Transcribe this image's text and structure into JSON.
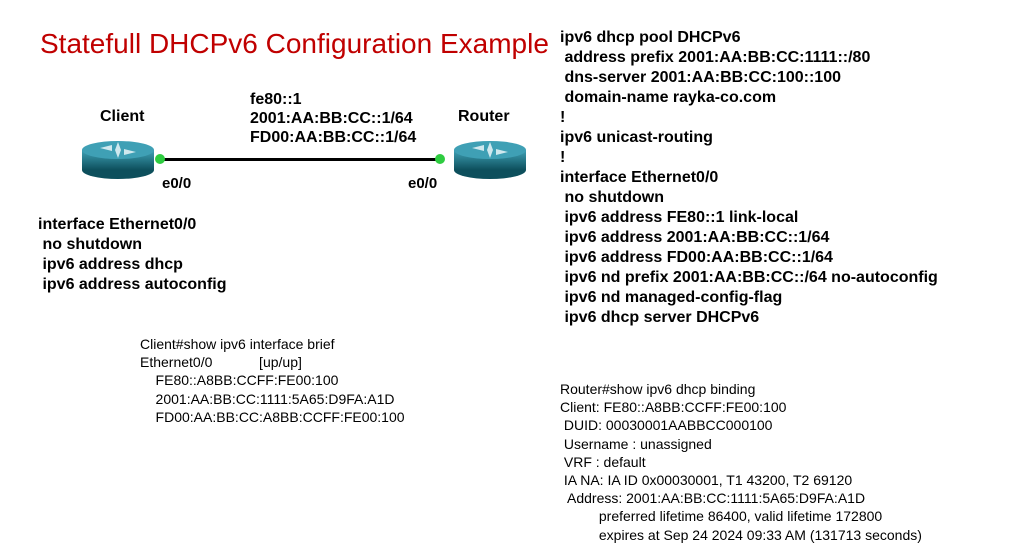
{
  "title": "Statefull DHCPv6 Configuration Example",
  "diagram": {
    "client_label": "Client",
    "router_label": "Router",
    "client_port": "e0/0",
    "router_port": "e0/0",
    "link_addrs": "fe80::1\n2001:AA:BB:CC::1/64\nFD00:AA:BB:CC::1/64"
  },
  "client_config": "interface Ethernet0/0\n no shutdown\n ipv6 address dhcp\n ipv6 address autoconfig",
  "router_config": "ipv6 dhcp pool DHCPv6\n address prefix 2001:AA:BB:CC:1111::/80\n dns-server 2001:AA:BB:CC:100::100\n domain-name rayka-co.com\n!\nipv6 unicast-routing\n!\ninterface Ethernet0/0\n no shutdown\n ipv6 address FE80::1 link-local\n ipv6 address 2001:AA:BB:CC::1/64\n ipv6 address FD00:AA:BB:CC::1/64\n ipv6 nd prefix 2001:AA:BB:CC::/64 no-autoconfig\n ipv6 nd managed-config-flag\n ipv6 dhcp server DHCPv6",
  "client_output": "Client#show ipv6 interface brief\nEthernet0/0            [up/up]\n    FE80::A8BB:CCFF:FE00:100\n    2001:AA:BB:CC:1111:5A65:D9FA:A1D\n    FD00:AA:BB:CC:A8BB:CCFF:FE00:100",
  "router_output": "Router#show ipv6 dhcp binding\nClient: FE80::A8BB:CCFF:FE00:100\n DUID: 00030001AABBCC000100\n Username : unassigned\n VRF : default\n IA NA: IA ID 0x00030001, T1 43200, T2 69120\n  Address: 2001:AA:BB:CC:1111:5A65:D9FA:A1D\n          preferred lifetime 86400, valid lifetime 172800\n          expires at Sep 24 2024 09:33 AM (131713 seconds)"
}
